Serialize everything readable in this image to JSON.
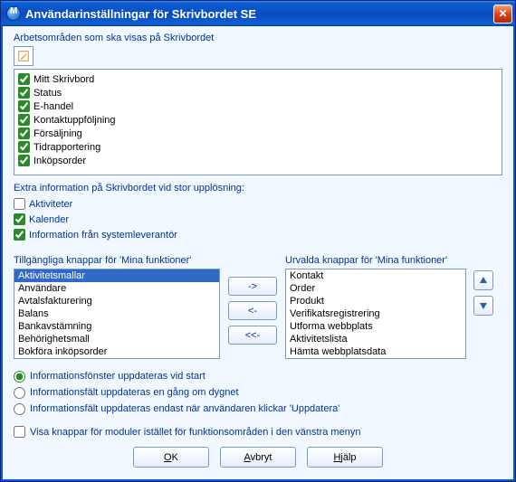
{
  "window": {
    "title": "Användarinställningar för Skrivbordet SE"
  },
  "workspaces": {
    "label": "Arbetsområden som ska visas på Skrivbordet",
    "items": [
      {
        "label": "Mitt Skrivbord",
        "checked": true
      },
      {
        "label": "Status",
        "checked": true
      },
      {
        "label": "E-handel",
        "checked": true
      },
      {
        "label": "Kontaktuppföljning",
        "checked": true
      },
      {
        "label": "Försäljning",
        "checked": true
      },
      {
        "label": "Tidrapportering",
        "checked": true
      },
      {
        "label": "Inköpsorder",
        "checked": true
      }
    ]
  },
  "extra": {
    "label": "Extra information på Skrivbordet vid stor upplösning:",
    "items": [
      {
        "label": "Aktiviteter",
        "checked": false
      },
      {
        "label": "Kalender",
        "checked": true
      },
      {
        "label": "Information från systemleverantör",
        "checked": true
      }
    ]
  },
  "available": {
    "label": "Tillgängliga knappar för 'Mina funktioner'",
    "items": [
      "Aktivitetsmallar",
      "Användare",
      "Avtalsfakturering",
      "Balans",
      "Bankavstämning",
      "Behörighetsmall",
      "Bokföra inköpsorder"
    ],
    "selected_index": 0
  },
  "selected": {
    "label": "Urvalda knappar för 'Mina funktioner'",
    "items": [
      "Kontakt",
      "Order",
      "Produkt",
      "Verifikatsregistrering",
      "Utforma webbplats",
      "Aktivitetslista",
      "Hämta webbplatsdata"
    ]
  },
  "move_buttons": {
    "right": "->",
    "left": "<-",
    "all_left": "<<-"
  },
  "radios": {
    "opt1": "Informationsfönster uppdateras vid start",
    "opt2": "Informationsfält uppdateras en gång om dygnet",
    "opt3": "Informationsfält uppdateras endast när användaren klickar 'Uppdatera'",
    "selected": 0
  },
  "module_checkbox": {
    "label": "Visa knappar för moduler istället för funktionsområden i den vänstra menyn",
    "checked": false
  },
  "buttons": {
    "ok": "OK",
    "cancel": "Avbryt",
    "help": "Hjälp"
  }
}
